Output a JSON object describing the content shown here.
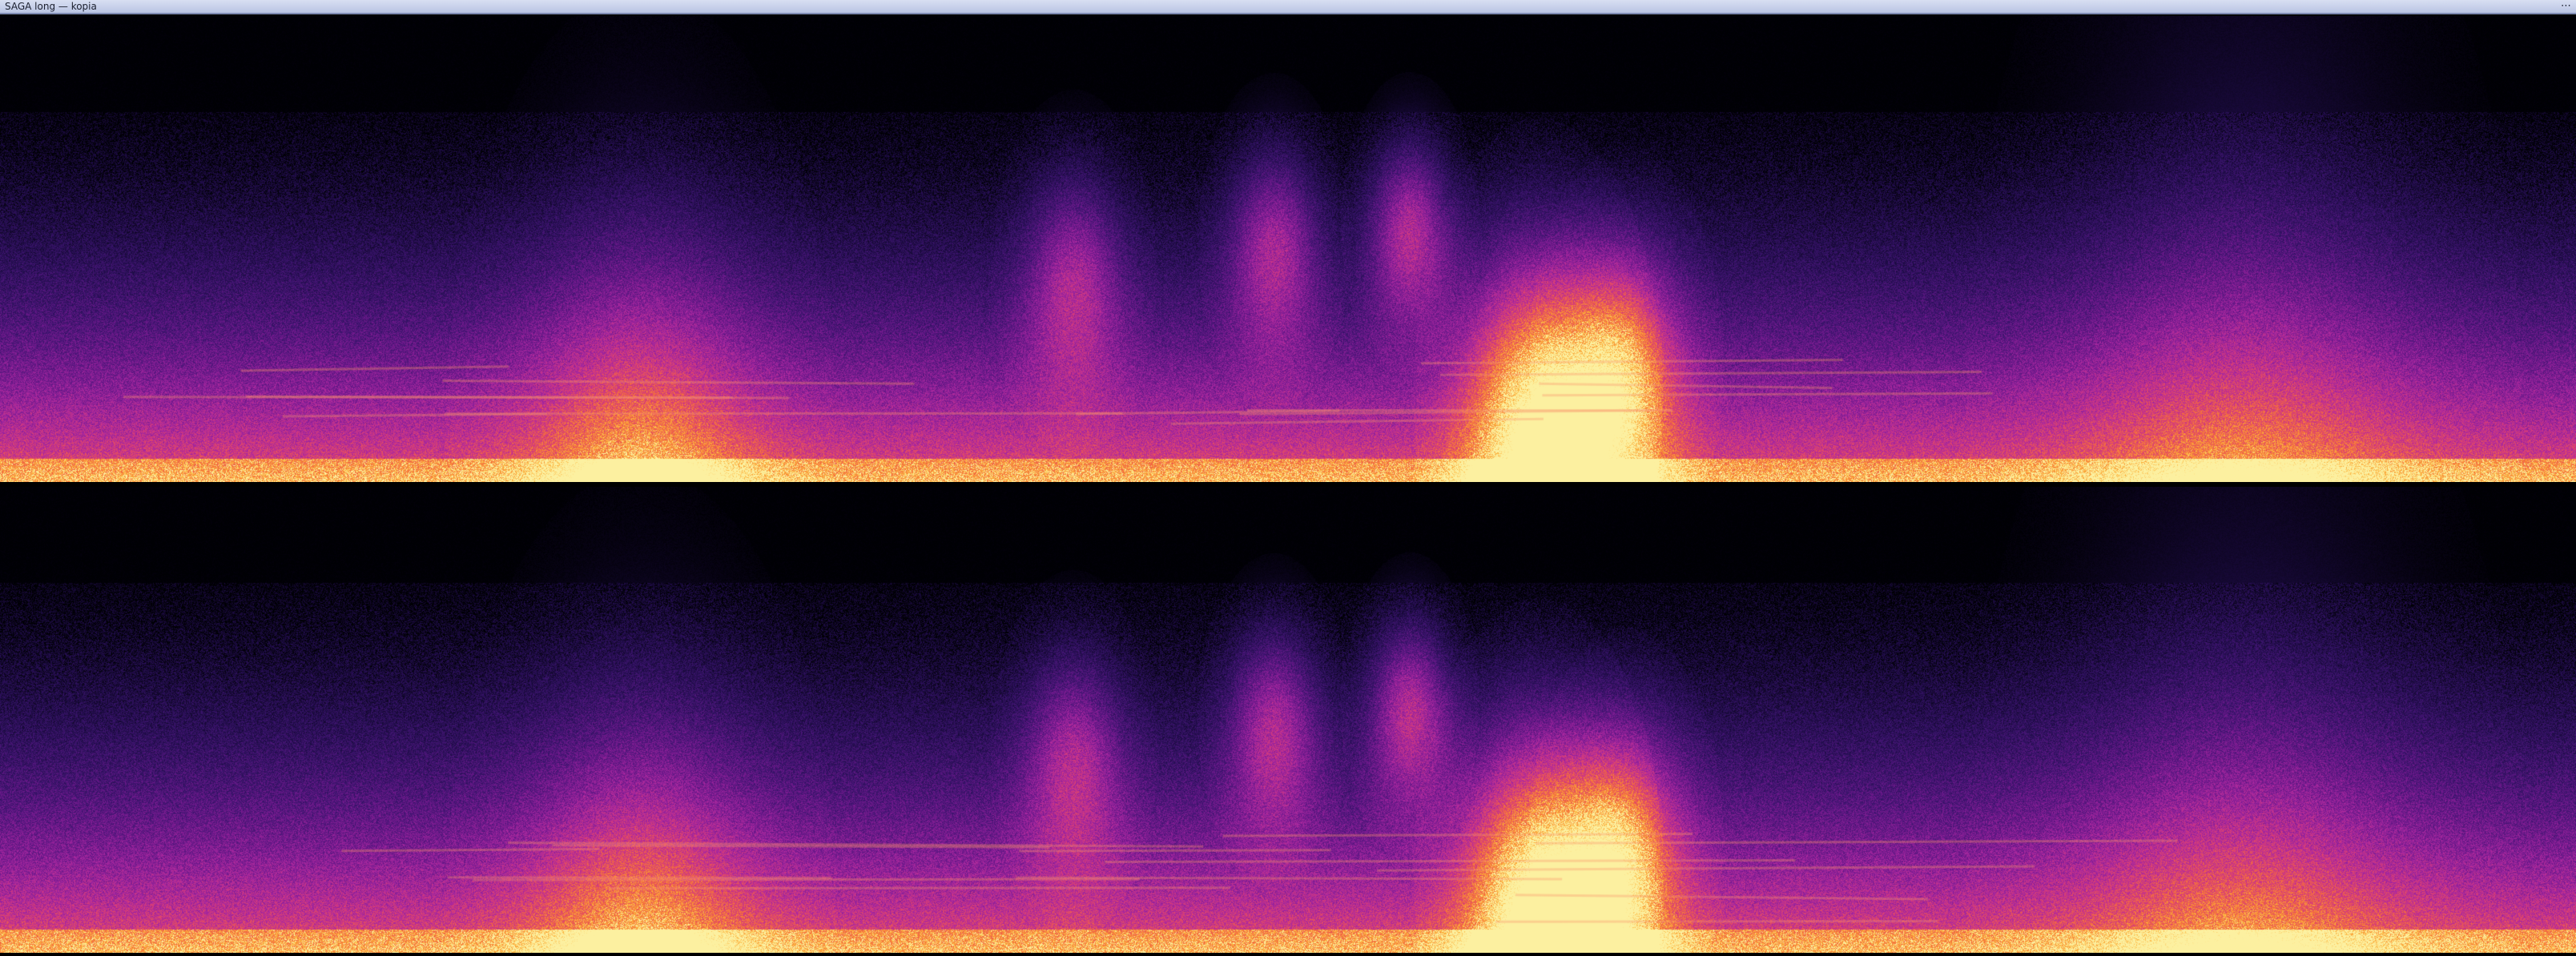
{
  "window": {
    "title": "SAGA long — kopia",
    "menu_glyph": "⋯"
  },
  "spectrogram": {
    "colormap": "inferno",
    "channels": [
      "top",
      "bottom"
    ]
  }
}
